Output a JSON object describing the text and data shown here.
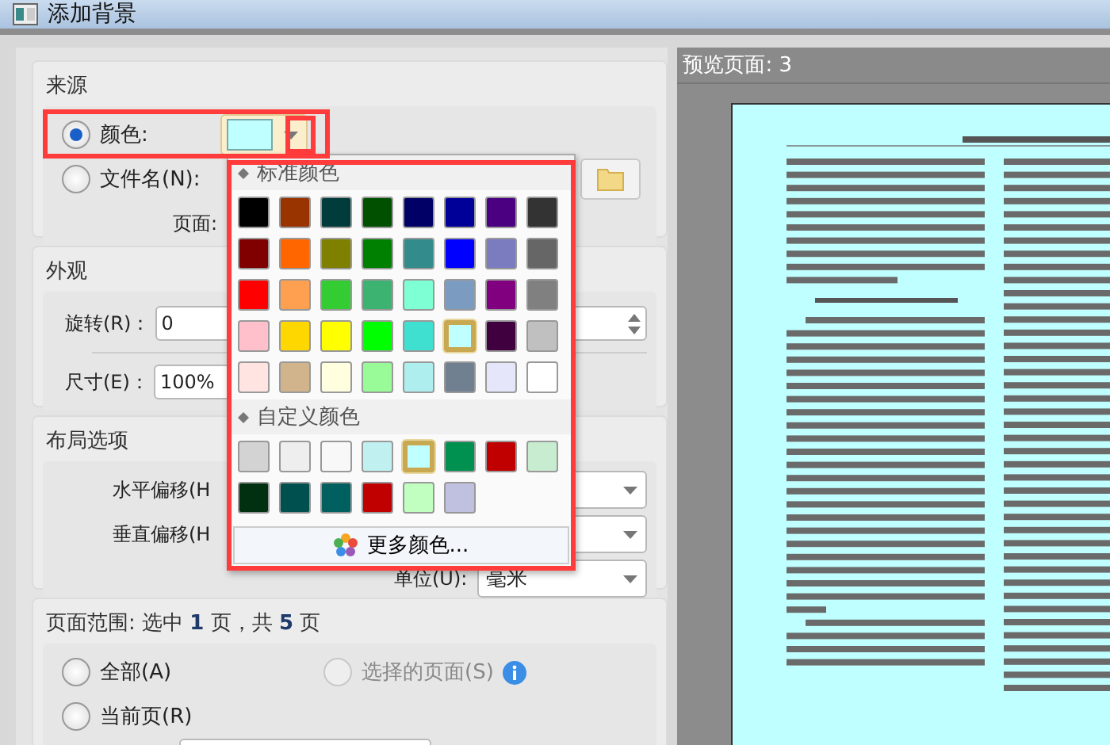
{
  "window": {
    "title": "添加背景"
  },
  "source": {
    "heading": "来源",
    "options": [
      {
        "label": "颜色:",
        "selected": true
      },
      {
        "label": "文件名(N):",
        "selected": false
      }
    ],
    "color_button": {
      "color": "#c0ffff"
    },
    "page_label": "页面:"
  },
  "appearance": {
    "heading": "外观",
    "rotation": {
      "label": "旋转(R)：",
      "value": "0"
    },
    "size": {
      "label": "尺寸(E)：",
      "value": "100%"
    }
  },
  "layout": {
    "heading": "布局选项",
    "horizontal_label": "水平偏移(H",
    "vertical_label": "垂直偏移(H",
    "unit": {
      "label": "单位(U):",
      "value": "毫米"
    }
  },
  "page_range": {
    "heading": "页面范围: 选中 **1** 页，共 **5** 页",
    "options": [
      {
        "label": "全部(A)",
        "selected": false,
        "disabled": false
      },
      {
        "label": "选择的页面(S)",
        "selected": false,
        "disabled": true
      },
      {
        "label": "当前页(R)",
        "selected": false,
        "disabled": false
      }
    ]
  },
  "color_popup": {
    "standard_heading": "标准颜色",
    "standard_colors": [
      {
        "color": "#000000",
        "selected": false
      },
      {
        "color": "#993300",
        "selected": false
      },
      {
        "color": "#003c3c",
        "selected": false
      },
      {
        "color": "#005000",
        "selected": false
      },
      {
        "color": "#000066",
        "selected": false
      },
      {
        "color": "#000099",
        "selected": false
      },
      {
        "color": "#4b0082",
        "selected": false
      },
      {
        "color": "#333333",
        "selected": false
      },
      {
        "color": "#800000",
        "selected": false
      },
      {
        "color": "#ff6600",
        "selected": false
      },
      {
        "color": "#808000",
        "selected": false
      },
      {
        "color": "#008000",
        "selected": false
      },
      {
        "color": "#338b8b",
        "selected": false
      },
      {
        "color": "#0000ff",
        "selected": false
      },
      {
        "color": "#7b7bc0",
        "selected": false
      },
      {
        "color": "#666666",
        "selected": false
      },
      {
        "color": "#ff0000",
        "selected": false
      },
      {
        "color": "#ffa050",
        "selected": false
      },
      {
        "color": "#33cc33",
        "selected": false
      },
      {
        "color": "#3cb371",
        "selected": false
      },
      {
        "color": "#7fffd4",
        "selected": false
      },
      {
        "color": "#7b9bc0",
        "selected": false
      },
      {
        "color": "#800080",
        "selected": false
      },
      {
        "color": "#808080",
        "selected": false
      },
      {
        "color": "#ffc0cb",
        "selected": false
      },
      {
        "color": "#ffd700",
        "selected": false
      },
      {
        "color": "#ffff00",
        "selected": false
      },
      {
        "color": "#00ff00",
        "selected": false
      },
      {
        "color": "#40e0d0",
        "selected": false
      },
      {
        "color": "#c0ffff",
        "selected": true
      },
      {
        "color": "#400040",
        "selected": false
      },
      {
        "color": "#c0c0c0",
        "selected": false
      },
      {
        "color": "#ffe4e1",
        "selected": false
      },
      {
        "color": "#d2b48c",
        "selected": false
      },
      {
        "color": "#ffffe0",
        "selected": false
      },
      {
        "color": "#98fb98",
        "selected": false
      },
      {
        "color": "#afeeee",
        "selected": false
      },
      {
        "color": "#708090",
        "selected": false
      },
      {
        "color": "#e6e6fa",
        "selected": false
      },
      {
        "color": "#ffffff",
        "selected": false
      }
    ],
    "custom_heading": "自定义颜色",
    "custom_colors": [
      {
        "color": "#d3d3d3",
        "selected": false
      },
      {
        "color": "#eeeeee",
        "selected": false
      },
      {
        "color": "#f8f8f8",
        "selected": false
      },
      {
        "color": "#c0f0f0",
        "selected": false
      },
      {
        "color": "#c0ffff",
        "selected": true
      },
      {
        "color": "#009050",
        "selected": false
      },
      {
        "color": "#c00000",
        "selected": false
      },
      {
        "color": "#c8ecd0",
        "selected": false
      },
      {
        "color": "#003010",
        "selected": false
      },
      {
        "color": "#005050",
        "selected": false
      },
      {
        "color": "#006060",
        "selected": false
      },
      {
        "color": "#c00000",
        "selected": false
      },
      {
        "color": "#c0ffc0",
        "selected": false
      },
      {
        "color": "#c0c0e0",
        "selected": false
      }
    ],
    "more_button": "更多颜色..."
  },
  "preview": {
    "title": "预览页面: 3"
  }
}
